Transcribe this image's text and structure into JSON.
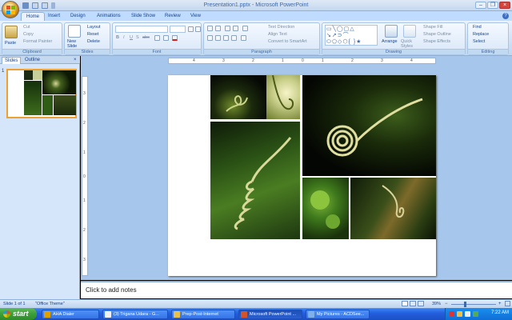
{
  "window": {
    "title": "Presentation1.pptx - Microsoft PowerPoint"
  },
  "tabs": [
    "Home",
    "Insert",
    "Design",
    "Animations",
    "Slide Show",
    "Review",
    "View"
  ],
  "ribbon": {
    "clipboard": {
      "paste": "Paste",
      "cut": "Cut",
      "copy": "Copy",
      "format_painter": "Format Painter",
      "label": "Clipboard"
    },
    "slides": {
      "new_slide": "New Slide",
      "layout": "Layout",
      "reset": "Reset",
      "delete": "Delete",
      "label": "Slides"
    },
    "font": {
      "label": "Font"
    },
    "paragraph": {
      "text_direction": "Text Direction",
      "align_text": "Align Text",
      "convert_smartart": "Convert to SmartArt",
      "label": "Paragraph"
    },
    "drawing": {
      "arrange": "Arrange",
      "quick_styles": "Quick Styles",
      "shape_fill": "Shape Fill",
      "shape_outline": "Shape Outline",
      "shape_effects": "Shape Effects",
      "label": "Drawing"
    },
    "editing": {
      "find": "Find",
      "replace": "Replace",
      "select": "Select",
      "label": "Editing"
    }
  },
  "side_pane": {
    "tab_slides": "Slides",
    "tab_outline": "Outline",
    "slide_number": "1"
  },
  "ruler": {
    "h_ticks": [
      "4",
      "3",
      "2",
      "1",
      "0",
      "1",
      "2",
      "3",
      "4"
    ],
    "v_ticks": [
      "3",
      "2",
      "1",
      "0",
      "1",
      "2",
      "3"
    ]
  },
  "notes": {
    "placeholder": "Click to add notes"
  },
  "status": {
    "slide_info": "Slide 1 of 1",
    "theme": "\"Office Theme\"",
    "zoom": "39%"
  },
  "taskbar": {
    "start": "start",
    "tasks": [
      "AHA Dialer",
      "(3) Trigana Udara - G...",
      "Prep-Post-Internet",
      "Microsoft PowerPoint ...",
      "My Pictures - ACDSee..."
    ],
    "clock": "7:22 AM"
  },
  "colors": {
    "accent": "#15428b",
    "ribbon_bg": "#dbe8f8",
    "slide_selection": "#f0a030"
  }
}
